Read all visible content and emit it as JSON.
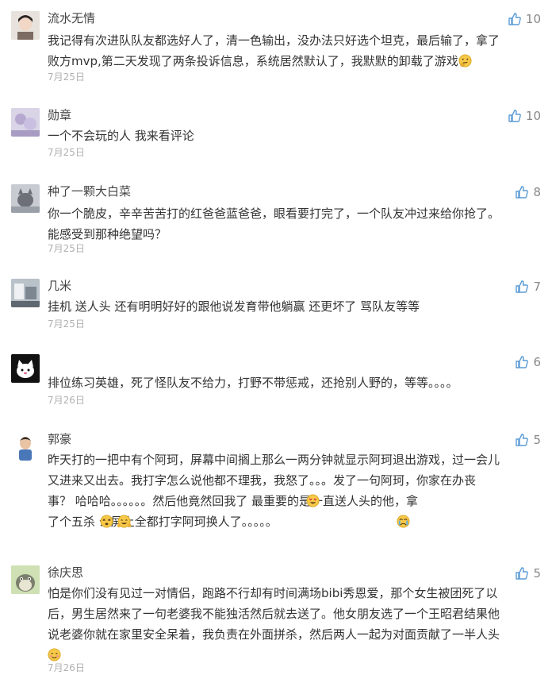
{
  "comments": [
    {
      "name": "流水无情",
      "lines": [
        "我记得有次进队队友都选好人了，清一色输出，没办法只好选个坦克，最后输了，拿了",
        "败方mvp,第二天发现了两条投诉信息，系统居然默认了，我默默的卸载了游戏"
      ],
      "date": "7月25日",
      "likes": "10",
      "avatar": "girl-photo-avatar"
    },
    {
      "name": "勋章",
      "lines": [
        "一个不会玩的人 我来看评论"
      ],
      "date": "7月25日",
      "likes": "10",
      "avatar": "blurry-photo-avatar"
    },
    {
      "name": "种了一颗大白菜",
      "lines": [
        "你一个脆皮，辛辛苦苦打的红爸爸蓝爸爸，眼看要打完了，一个队友冲过来给你抢了。",
        "能感受到那种绝望吗？"
      ],
      "date": "7月25日",
      "likes": "8",
      "avatar": "cat-photo-avatar"
    },
    {
      "name": "几米",
      "lines": [
        "挂机  送人头  还有明明好好的跟他说发育带他躺赢  还更坏了  骂队友等等"
      ],
      "date": "7月25日",
      "likes": "7",
      "avatar": "room-photo-avatar"
    },
    {
      "name": "",
      "lines": [
        "排位练习英雄，死了怪队友不给力，打野不带惩戒，还抢别人野的，等等。。。。"
      ],
      "date": "7月26日",
      "likes": "6",
      "avatar": "cartoon-cat-avatar"
    },
    {
      "name": "郭豪",
      "lines": [
        "昨天打的一把中有个阿珂，屏幕中间搁上那么一两分钟就显示阿珂退出游戏，过一会儿",
        "又进来又出去。我打字怎么说他都不理我，我怒了。。。发了一句阿珂，你家在办丧",
        "事？      哈哈哈。。。。。。然后他竟然回我了            最重要的是一直送人头的他，拿",
        "了个五杀                    公屏上全都打字阿珂换人了。。。。。"
      ],
      "date": "",
      "likes": "5",
      "avatar": "boy-photo-avatar"
    },
    {
      "name": "徐庆思",
      "lines": [
        "怕是你们没有见过一对情侣，跑路不行却有时间满场bibi秀恩爱，那个女生被团死了以",
        "后，男生居然来了一句老婆我不能独活然后就去送了。他女朋友选了一个王昭君结果他",
        "说老婆你就在家里安全呆着，我负责在外面拼杀，然后两人一起为对面贡献了一半人头",
        ""
      ],
      "date": "7月26日",
      "likes": "5",
      "avatar": "totoro-avatar"
    }
  ],
  "colors": {
    "name": "#444444",
    "text": "#333333",
    "date": "#b0b0b0",
    "like": "#888888",
    "thumb": "#5b9bd5"
  }
}
